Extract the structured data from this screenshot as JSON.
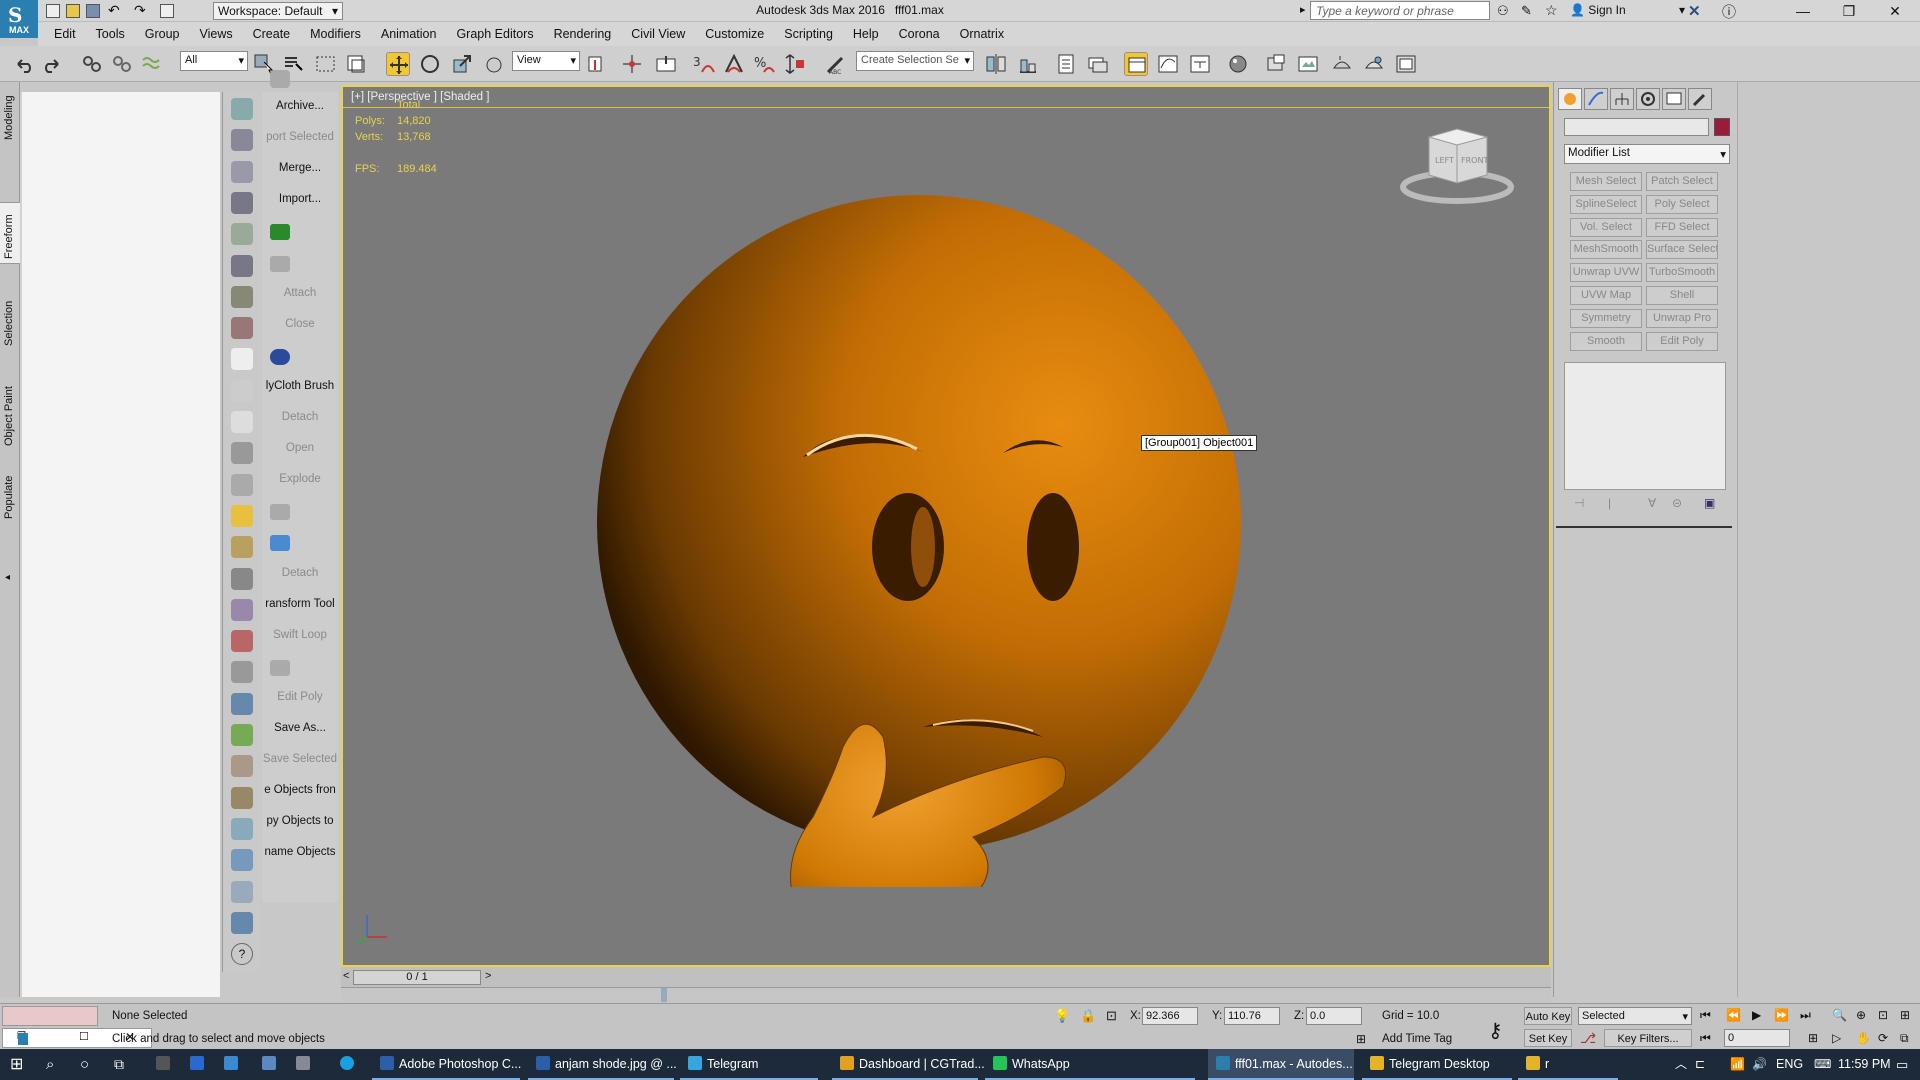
{
  "app": {
    "title": "Autodesk 3ds Max 2016",
    "filename": "fff01.max",
    "logo_label": "MAX",
    "workspace": "Workspace: Default",
    "search_placeholder": "Type a keyword or phrase",
    "sign_in": "Sign In"
  },
  "menu": [
    "Edit",
    "Tools",
    "Group",
    "Views",
    "Create",
    "Modifiers",
    "Animation",
    "Graph Editors",
    "Rendering",
    "Civil View",
    "Customize",
    "Scripting",
    "Help",
    "Corona",
    "Ornatrix"
  ],
  "toolbar": {
    "filter_select": "All",
    "ref_coord": "View",
    "selection_set": "Create Selection Se"
  },
  "vtabs": [
    "Modeling",
    "Freeform",
    "Selection",
    "Object Paint",
    "Populate"
  ],
  "ribbon_commands": [
    {
      "label": "Archive...",
      "dim": false
    },
    {
      "label": "port Selected",
      "dim": true
    },
    {
      "label": "Merge...",
      "dim": false
    },
    {
      "label": "Import...",
      "dim": false
    },
    {
      "label": "",
      "dim": false
    },
    {
      "label": "",
      "dim": false
    },
    {
      "label": "Attach",
      "dim": true
    },
    {
      "label": "Close",
      "dim": true
    },
    {
      "label": "",
      "dim": false
    },
    {
      "label": "lyCloth Brush",
      "dim": false
    },
    {
      "label": "Detach",
      "dim": true
    },
    {
      "label": "Open",
      "dim": true
    },
    {
      "label": "Explode",
      "dim": true
    },
    {
      "label": "",
      "dim": false
    },
    {
      "label": "",
      "dim": false
    },
    {
      "label": "Detach",
      "dim": true
    },
    {
      "label": "ransform Tool",
      "dim": false
    },
    {
      "label": "Swift Loop",
      "dim": true
    },
    {
      "label": "",
      "dim": false
    },
    {
      "label": "Edit Poly",
      "dim": true
    },
    {
      "label": "Save As...",
      "dim": false
    },
    {
      "label": "Save Selected",
      "dim": true
    },
    {
      "label": "e Objects fron",
      "dim": false
    },
    {
      "label": "py Objects to",
      "dim": false
    },
    {
      "label": "name Objects",
      "dim": false
    }
  ],
  "viewport": {
    "label": "[+] [Perspective ] [Shaded ]",
    "stats_header": "Total",
    "polys_label": "Polys:",
    "polys_value": "14,820",
    "verts_label": "Verts:",
    "verts_value": "13,768",
    "fps_label": "FPS:",
    "fps_value": "189.484",
    "tooltip": "[Group001] Object001",
    "viewcube_left": "LEFT",
    "viewcube_front": "FRONT",
    "model_color": "#d07a05"
  },
  "command_panel": {
    "modifier_list": "Modifier List",
    "buttons": [
      "Mesh Select",
      "Patch Select",
      "SplineSelect",
      "Poly Select",
      "Vol. Select",
      "FFD Select",
      "MeshSmooth",
      "Surface Select",
      "Unwrap UVW",
      "TurboSmooth",
      "UVW Map",
      "Shell",
      "Symmetry",
      "Unwrap Pro",
      "Smooth",
      "Edit Poly"
    ]
  },
  "timeline": {
    "frame": "0 / 1"
  },
  "status": {
    "selection": "None Selected",
    "prompt": "Click and drag to select and move objects",
    "x_label": "X:",
    "x_value": "92.366",
    "y_label": "Y:",
    "y_value": "110.76",
    "z_label": "Z:",
    "z_value": "0.0",
    "grid": "Grid = 10.0",
    "add_time_tag": "Add Time Tag",
    "auto_key": "Auto Key",
    "set_key": "Set Key",
    "key_mode": "Selected",
    "key_filters": "Key Filters...",
    "frame_field": "0"
  },
  "taskbar": {
    "apps": [
      {
        "label": "Adobe Photoshop C...",
        "color": "#2b5fa8",
        "active": false
      },
      {
        "label": "anjam shode.jpg @ ...",
        "color": "#2b5fa8",
        "active": false
      },
      {
        "label": "Telegram",
        "color": "#37a6de",
        "active": false
      },
      {
        "label": "Dashboard | CGTrad...",
        "color": "#e0a020",
        "active": false
      },
      {
        "label": "WhatsApp",
        "color": "#25c35a",
        "active": false
      },
      {
        "label": "fff01.max - Autodes...",
        "color": "#2a7fb0",
        "active": true
      },
      {
        "label": "Telegram Desktop",
        "color": "#e3b32a",
        "active": false
      },
      {
        "label": "r",
        "color": "#e3b32a",
        "active": false
      }
    ],
    "lang": "ENG",
    "clock": "11:59 PM"
  }
}
